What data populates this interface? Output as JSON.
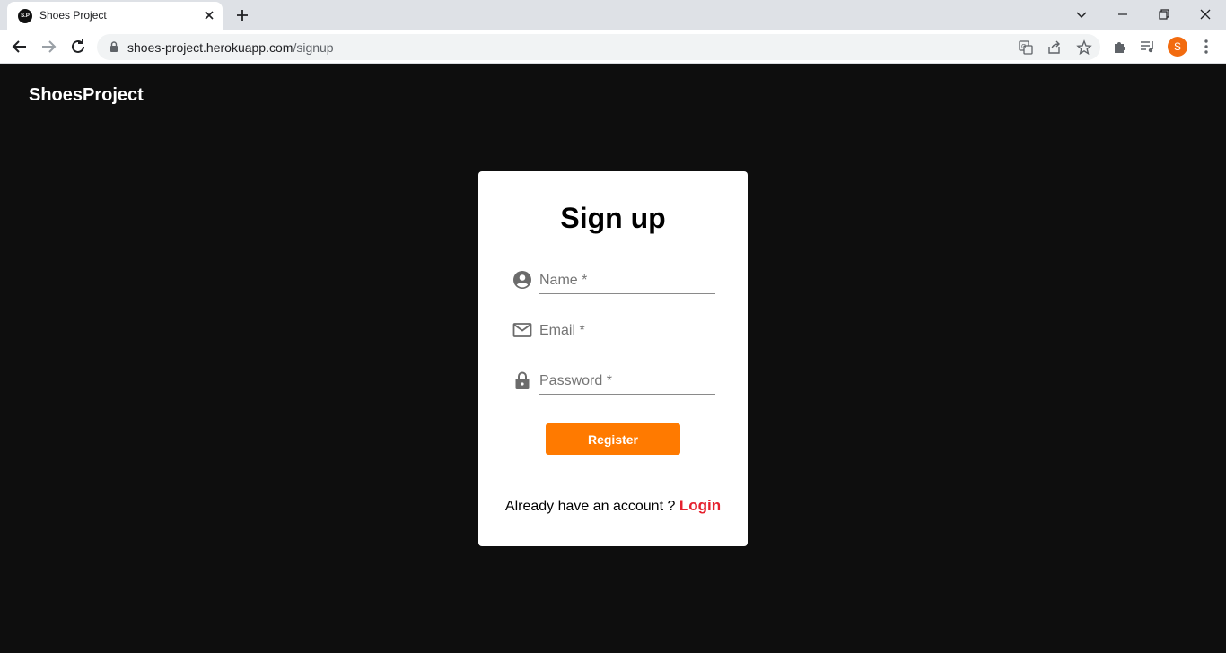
{
  "browser": {
    "tab_title": "Shoes Project",
    "favicon_text": "S.P",
    "url_host": "shoes-project.herokuapp.com",
    "url_path": "/signup",
    "profile_initial": "S"
  },
  "header": {
    "brand": "ShoesProject"
  },
  "signup": {
    "title": "Sign up",
    "fields": [
      {
        "icon": "account-circle-icon",
        "placeholder": "Name *"
      },
      {
        "icon": "mail-icon",
        "placeholder": "Email *"
      },
      {
        "icon": "lock-icon",
        "placeholder": "Password *"
      }
    ],
    "register_label": "Register",
    "already_text": "Already have an account ? ",
    "login_label": "Login"
  },
  "colors": {
    "page_background": "#0e0e0e",
    "accent": "#ff7a00",
    "link": "#e5202d"
  }
}
